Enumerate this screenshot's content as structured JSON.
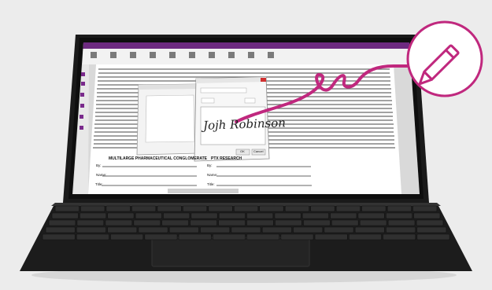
{
  "pdf_app": {
    "ribbon_color": "#7a2a8c",
    "document_labels": {
      "left_party": "MULTILARGE PHARMACEUTICAL CONGLOMERATE",
      "right_party": "PTX RESEARCH",
      "by_label": "By:",
      "name_label": "Name:",
      "title_label": "Title:"
    },
    "signature_dialog": {
      "signature_text": "Jojh Robinson",
      "ok_label": "OK",
      "cancel_label": "Cancel"
    }
  },
  "overlay": {
    "icon": "pen-icon",
    "accent_color": "#c0287e"
  }
}
